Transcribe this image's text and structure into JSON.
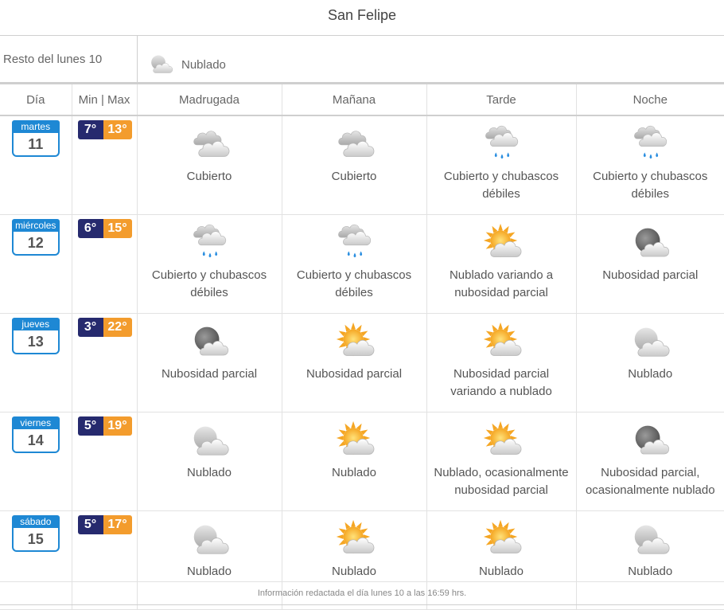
{
  "location": "San Felipe",
  "rest": {
    "label": "Resto del lunes 10",
    "icon": "cloud-moon-icon",
    "text": "Nublado"
  },
  "headers": [
    "Día",
    "Min | Max",
    "Madrugada",
    "Mañana",
    "Tarde",
    "Noche"
  ],
  "days": [
    {
      "weekday": "martes",
      "date": "11",
      "min": "7°",
      "max": "13°",
      "periods": [
        {
          "icon": "overcast-icon",
          "text": "Cubierto"
        },
        {
          "icon": "overcast-icon",
          "text": "Cubierto"
        },
        {
          "icon": "rain-showers-icon",
          "text": "Cubierto y chubascos débiles"
        },
        {
          "icon": "rain-showers-icon",
          "text": "Cubierto y chubascos débiles"
        }
      ]
    },
    {
      "weekday": "miércoles",
      "date": "12",
      "min": "6°",
      "max": "15°",
      "periods": [
        {
          "icon": "rain-showers-icon",
          "text": "Cubierto y chubascos débiles"
        },
        {
          "icon": "rain-showers-icon",
          "text": "Cubierto y chubascos débiles"
        },
        {
          "icon": "sun-cloud-icon",
          "text": "Nublado variando a nubosidad parcial"
        },
        {
          "icon": "moon-cloud-icon",
          "text": "Nubosidad parcial"
        }
      ]
    },
    {
      "weekday": "jueves",
      "date": "13",
      "min": "3°",
      "max": "22°",
      "periods": [
        {
          "icon": "moon-cloud-icon",
          "text": "Nubosidad parcial"
        },
        {
          "icon": "sun-cloud-icon",
          "text": "Nubosidad parcial"
        },
        {
          "icon": "sun-cloud-icon",
          "text": "Nubosidad parcial variando a nublado"
        },
        {
          "icon": "cloud-moon-icon",
          "text": "Nublado"
        }
      ]
    },
    {
      "weekday": "viernes",
      "date": "14",
      "min": "5°",
      "max": "19°",
      "periods": [
        {
          "icon": "cloud-moon-icon",
          "text": "Nublado"
        },
        {
          "icon": "sun-cloud-icon",
          "text": "Nublado"
        },
        {
          "icon": "sun-cloud-icon",
          "text": "Nublado, ocasionalmente nubosidad parcial"
        },
        {
          "icon": "moon-cloud-icon",
          "text": "Nubosidad parcial, ocasionalmente nublado"
        }
      ]
    },
    {
      "weekday": "sábado",
      "date": "15",
      "min": "5°",
      "max": "17°",
      "periods": [
        {
          "icon": "cloud-moon-icon",
          "text": "Nublado"
        },
        {
          "icon": "sun-cloud-icon",
          "text": "Nublado"
        },
        {
          "icon": "sun-cloud-icon",
          "text": "Nublado"
        },
        {
          "icon": "cloud-moon-icon",
          "text": "Nublado"
        }
      ]
    }
  ],
  "footer": "Información redactada el día lunes 10 a las 16:59 hrs.",
  "colors": {
    "calendar": "#1e88d4",
    "min": "#262a6e",
    "max": "#f39c2d"
  }
}
